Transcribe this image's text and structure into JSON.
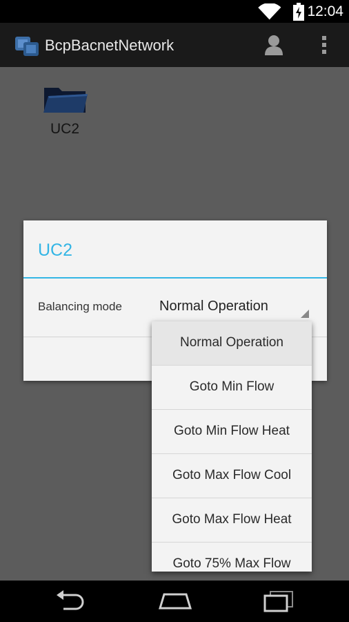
{
  "status_bar": {
    "time": "12:04",
    "icons": [
      "wifi-icon",
      "battery-charging-icon"
    ]
  },
  "action_bar": {
    "title": "BcpBacnetNetwork",
    "icons": [
      "app-icon",
      "person-icon",
      "overflow-menu-icon"
    ]
  },
  "content": {
    "items": [
      {
        "label": "UC2",
        "icon": "folder-icon"
      }
    ]
  },
  "dialog": {
    "title": "UC2",
    "setting_label": "Balancing mode",
    "selected_value": "Normal Operation"
  },
  "dropdown": {
    "options": [
      "Normal Operation",
      "Goto Min Flow",
      "Goto Min Flow Heat",
      "Goto Max Flow Cool",
      "Goto Max Flow Heat",
      "Goto 75% Max Flow"
    ],
    "selected_index": 0
  },
  "nav_bar": {
    "icons": [
      "back-icon",
      "home-icon",
      "recent-apps-icon"
    ]
  },
  "colors": {
    "accent": "#33b5e5",
    "scrim": "#5c5c5c",
    "dialog_bg": "#f3f3f3"
  }
}
